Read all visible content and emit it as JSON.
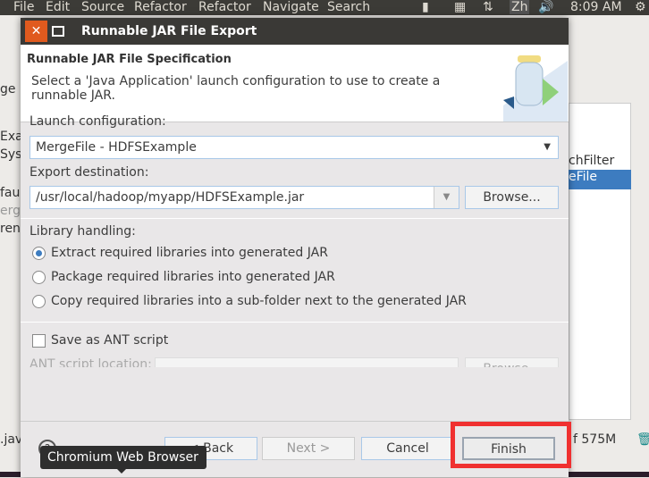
{
  "menubar": {
    "items": [
      "File",
      "Edit",
      "Source",
      "Refactor",
      "Refactor",
      "Navigate",
      "Search"
    ],
    "clock": "8:09 AM",
    "keyboard": "Zh"
  },
  "background": {
    "left_fragments": [
      "ge E",
      "Exa",
      "Sys",
      "fau",
      "erg",
      "ren",
      ".jav"
    ],
    "right_fragments": [
      "chFilter",
      "eFile"
    ],
    "memory": "f 575M"
  },
  "dialog": {
    "title": "Runnable JAR File Export",
    "header_title": "Runnable JAR File Specification",
    "header_desc": "Select a 'Java Application' launch configuration to use to create a runnable JAR.",
    "launch_label": "Launch configuration:",
    "launch_value": "MergeFile - HDFSExample",
    "dest_label": "Export destination:",
    "dest_value": "/usr/local/hadoop/myapp/HDFSExample.jar",
    "browse": "Browse...",
    "library_label": "Library handling:",
    "library_options": [
      "Extract required libraries into generated JAR",
      "Package required libraries into generated JAR",
      "Copy required libraries into a sub-folder next to the generated JAR"
    ],
    "library_selected": 0,
    "ant_checkbox": "Save as ANT script",
    "ant_location_label": "ANT script location:",
    "ant_browse": "Browse...",
    "buttons": {
      "back": "< Back",
      "next": "Next >",
      "cancel": "Cancel",
      "finish": "Finish"
    }
  },
  "tooltip": "Chromium Web Browser",
  "colors": {
    "highlight": "#f03030",
    "accent": "#3d7cc0",
    "close": "#e05a1e"
  }
}
